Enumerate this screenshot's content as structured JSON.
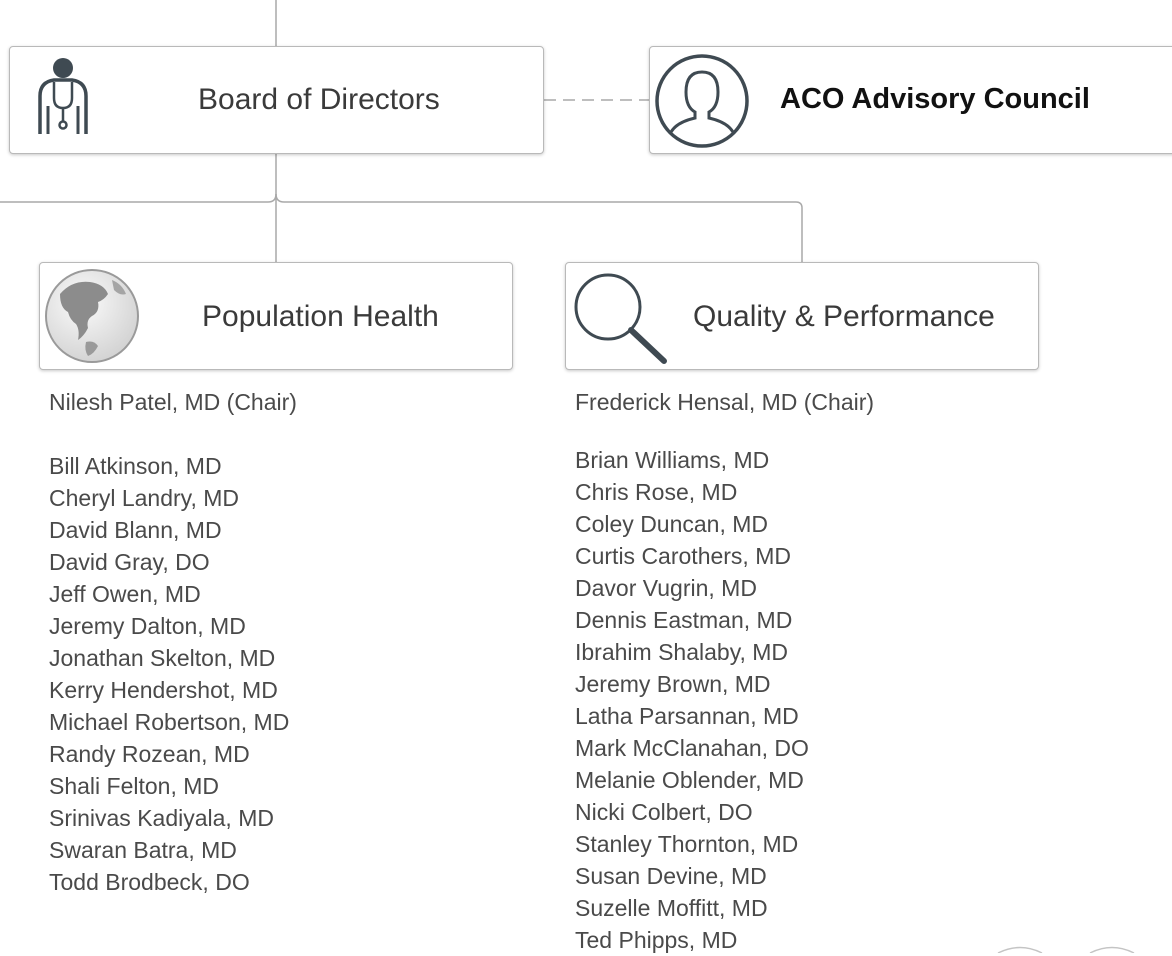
{
  "board": {
    "label": "Board of Directors",
    "icon": "doctor-icon"
  },
  "advisory": {
    "label": "ACO Advisory Council",
    "icon": "person-silhouette-icon"
  },
  "population_health": {
    "label": "Population Health",
    "icon": "globe-icon",
    "chair": "Nilesh Patel, MD (Chair)",
    "members": [
      "Bill Atkinson, MD",
      "Cheryl Landry, MD",
      "David Blann, MD",
      "David Gray, DO",
      "Jeff Owen, MD",
      "Jeremy Dalton, MD",
      "Jonathan Skelton, MD",
      "Kerry Hendershot, MD",
      "Michael Robertson, MD",
      "Randy Rozean, MD",
      "Shali Felton, MD",
      "Srinivas Kadiyala, MD",
      "Swaran Batra, MD",
      "Todd Brodbeck, DO"
    ]
  },
  "quality_performance": {
    "label": "Quality & Performance",
    "icon": "magnifier-icon",
    "chair": "Frederick Hensal, MD (Chair)",
    "members": [
      "Brian Williams, MD",
      "Chris Rose, MD",
      "Coley Duncan, MD",
      "Curtis Carothers, MD",
      "Davor Vugrin, MD",
      "Dennis Eastman, MD",
      "Ibrahim Shalaby, MD",
      "Jeremy Brown, MD",
      "Latha Parsannan, MD",
      "Mark McClanahan, DO",
      "Melanie Oblender, MD",
      "Nicki Colbert, DO",
      "Stanley Thornton, MD",
      "Susan Devine, MD",
      "Suzelle Moffitt, MD",
      "Ted Phipps, MD"
    ]
  },
  "colors": {
    "line": "#a9a9a9",
    "box_border": "#b9b9b9",
    "text": "#3a3a3a",
    "icon": "#3f4a52"
  }
}
